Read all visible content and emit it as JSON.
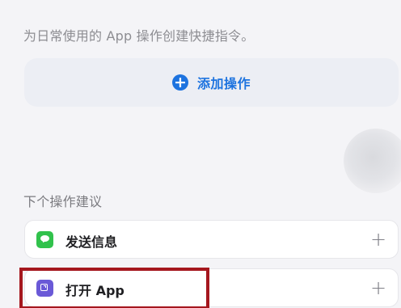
{
  "header": {
    "description": "为日常使用的 App 操作创建快捷指令。"
  },
  "add_action": {
    "label": "添加操作",
    "icon": "plus-circle-icon"
  },
  "suggestions": {
    "title": "下个操作建议",
    "items": [
      {
        "label": "发送信息",
        "icon": "messages-icon",
        "action_icon": "plus-icon",
        "action_label": "+"
      },
      {
        "label": "打开 App",
        "icon": "open-app-icon",
        "action_icon": "plus-icon",
        "action_label": "+"
      }
    ]
  },
  "colors": {
    "background": "#f4f4f7",
    "accent_blue": "#1d73df",
    "messages_green": "#31c24c",
    "open_app_purple": "#6a59d7",
    "highlight_red": "#a5171e"
  }
}
